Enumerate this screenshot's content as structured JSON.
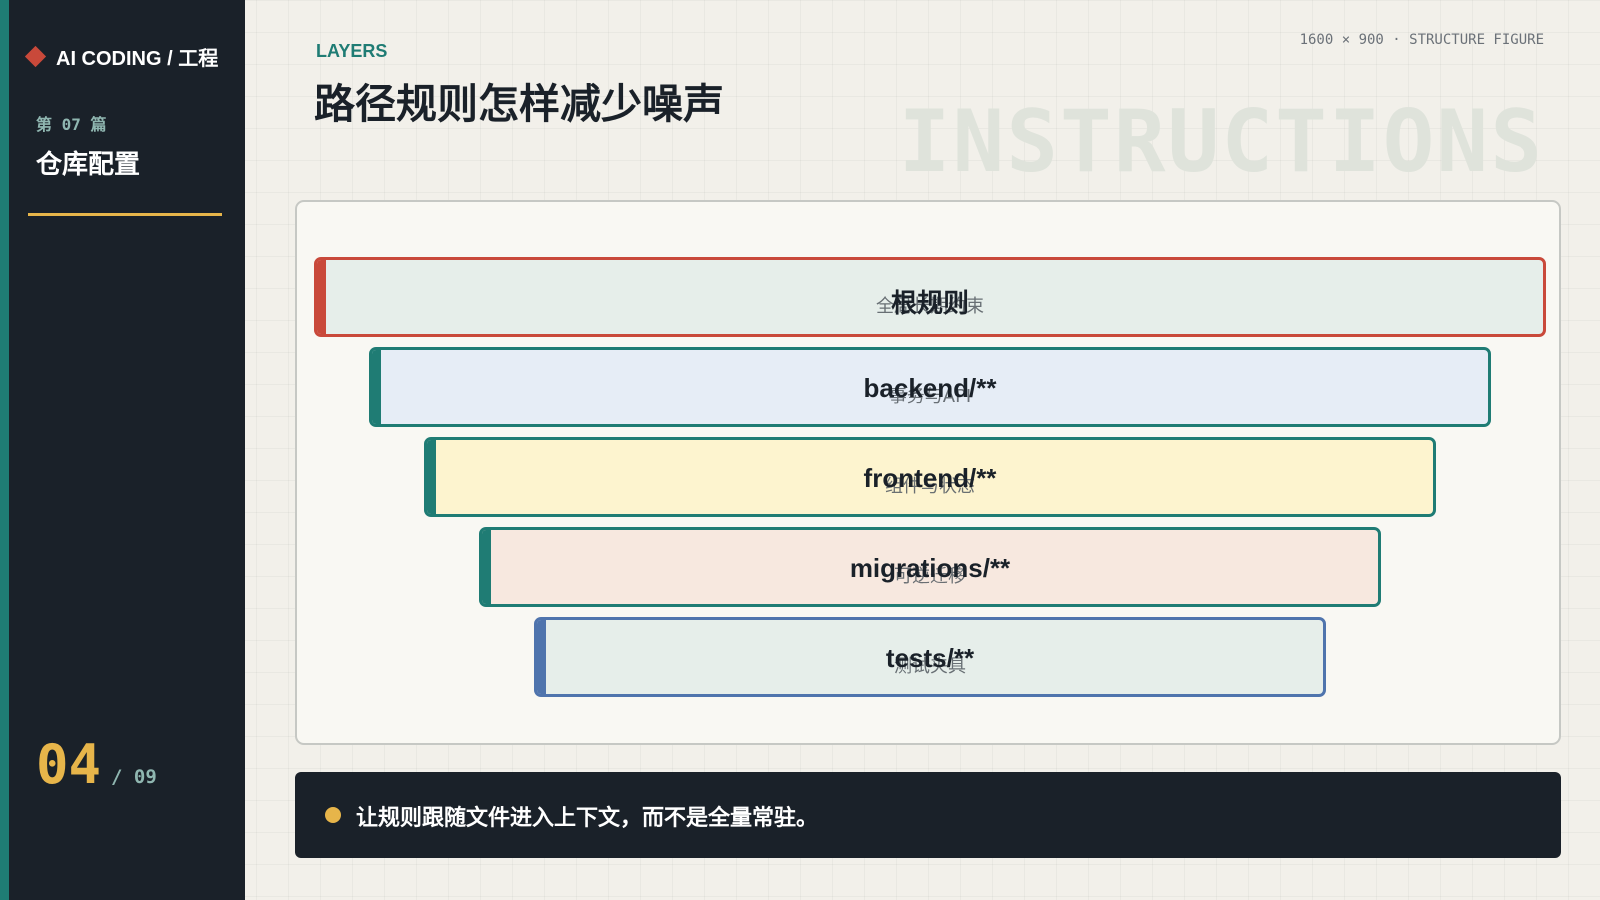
{
  "sidebar": {
    "brand": "AI CODING / 工程",
    "chapter_number": "第 07 篇",
    "chapter_title": "仓库配置",
    "page_current": "04",
    "page_total": "/ 09"
  },
  "header": {
    "eyebrow": "LAYERS",
    "title": "路径规则怎样减少噪声",
    "meta": "1600 × 900 · STRUCTURE FIGURE",
    "watermark": "INSTRUCTIONS"
  },
  "layers": [
    {
      "label": "根规则",
      "note": "全局长期约束",
      "accent": "#c9493a",
      "border": "#c9493a",
      "fill": "#e6eeea"
    },
    {
      "label": "backend/**",
      "note": "事务与API",
      "accent": "#1f7c74",
      "border": "#1f7c74",
      "fill": "#e6edf6"
    },
    {
      "label": "frontend/**",
      "note": "组件与状态",
      "accent": "#1f7c74",
      "border": "#1f7c74",
      "fill": "#fdf4cf"
    },
    {
      "label": "migrations/**",
      "note": "可逆迁移",
      "accent": "#1f7c74",
      "border": "#1f7c74",
      "fill": "#f7e8df"
    },
    {
      "label": "tests/**",
      "note": "测试夹具",
      "accent": "#4f74ad",
      "border": "#4f74ad",
      "fill": "#e6eeea"
    }
  ],
  "banner": {
    "text": "让规则跟随文件进入上下文，而不是全量常驻。"
  }
}
